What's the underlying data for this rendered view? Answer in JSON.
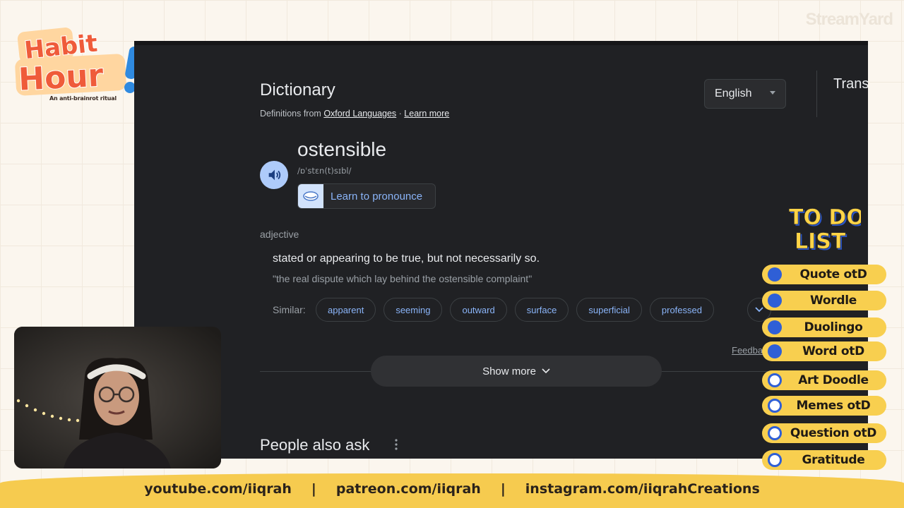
{
  "overlay": {
    "logo": {
      "line1": "Habit",
      "line2": "Hour",
      "tagline": "An anti-brainrot ritual"
    },
    "watermark": "StreamYard",
    "todo": {
      "title_line1": "TO DO",
      "title_line2": "LIST",
      "items": [
        {
          "label": "Quote otD",
          "done": true
        },
        {
          "label": "Wordle",
          "done": true
        },
        {
          "label": "Duolingo",
          "done": true
        },
        {
          "label": "Word otD",
          "done": true
        },
        {
          "label": "Art Doodle",
          "done": false
        },
        {
          "label": "Memes otD",
          "done": false
        },
        {
          "label": "Question otD",
          "done": false
        },
        {
          "label": "Gratitude",
          "done": false
        }
      ]
    },
    "footer": {
      "link1": "youtube.com/iiqrah",
      "sep": "|",
      "link2": "patreon.com/iiqrah",
      "link3": "instagram.com/iiqrahCreations"
    }
  },
  "dictionary": {
    "title": "Dictionary",
    "source_prefix": "Definitions from",
    "source_name": "Oxford Languages",
    "source_dot": " · ",
    "learn_more": "Learn more",
    "language": "English",
    "translate_tab": "Trans",
    "word": "ostensible",
    "phonetic": "/ɒˈstɛn(t)sɪbl/",
    "pronounce_label": "Learn to pronounce",
    "part_of_speech": "adjective",
    "definition": "stated or appearing to be true, but not necessarily so.",
    "example": "\"the real dispute which lay behind the ostensible complaint\"",
    "similar_label": "Similar:",
    "similar": [
      "apparent",
      "seeming",
      "outward",
      "surface",
      "superficial",
      "professed"
    ],
    "feedback": "Feedback",
    "show_more": "Show more",
    "people_also_ask": "People also ask"
  },
  "colors": {
    "accent_yellow": "#f8cf4f",
    "accent_blue": "#2f5fd6",
    "link_blue": "#8ab4f8",
    "dark_bg": "#202124"
  }
}
